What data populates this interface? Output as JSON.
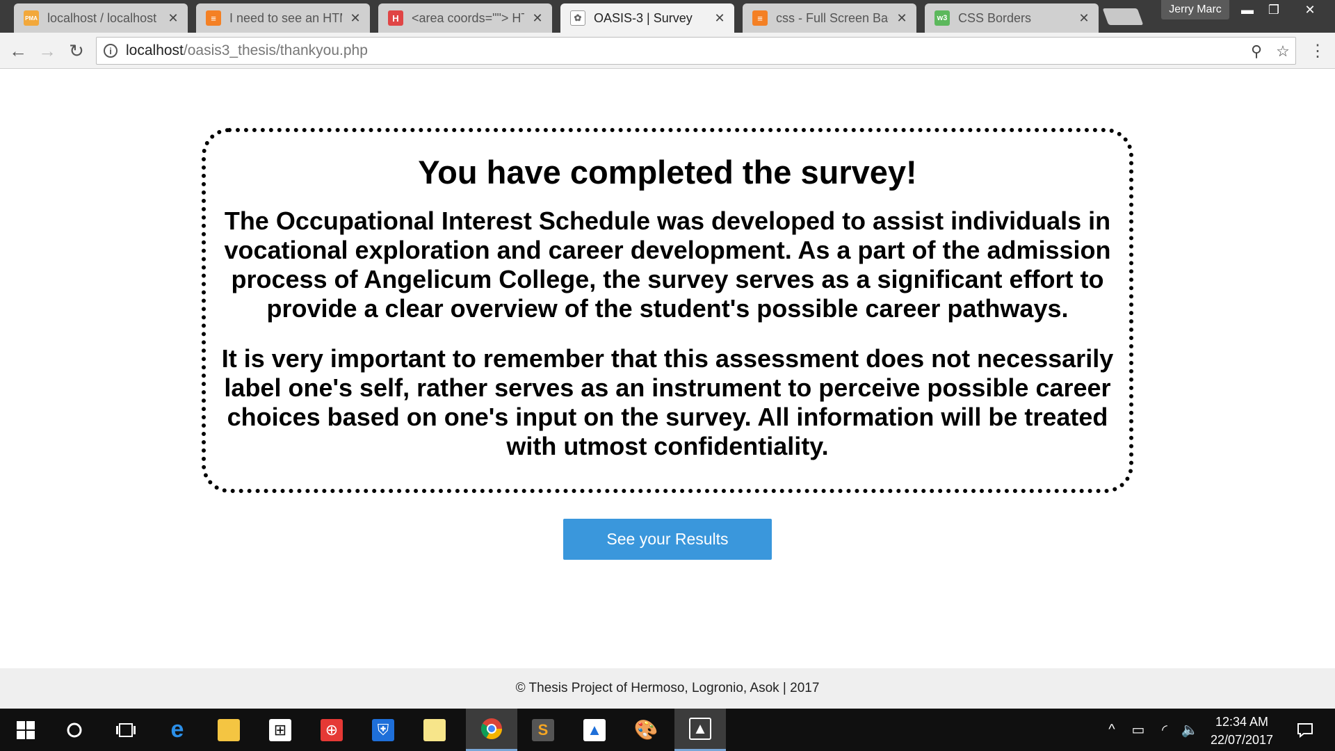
{
  "browser": {
    "tabs": [
      {
        "label": "localhost / localhost /",
        "favicon": "phpmyadmin-icon",
        "color": "#f2a83b",
        "glyph": "PMA"
      },
      {
        "label": "I need to see an HTM",
        "favicon": "stackoverflow-icon",
        "color": "#f48024",
        "glyph": "≡"
      },
      {
        "label": "<area coords=\"\"> HT",
        "favicon": "h-logo-icon",
        "color": "#e04545",
        "glyph": "H"
      },
      {
        "label": "OASIS-3 | Survey",
        "favicon": "oasis-seal-icon",
        "color": "#8a8a5a",
        "glyph": "✿"
      },
      {
        "label": "css - Full Screen Back",
        "favicon": "stackoverflow-icon",
        "color": "#f48024",
        "glyph": "≡"
      },
      {
        "label": "CSS Borders",
        "favicon": "w3schools-icon",
        "color": "#5cb85c",
        "glyph": "w3"
      }
    ],
    "active_tab_index": 3,
    "profile_name": "Jerry Marc",
    "url": {
      "host": "localhost",
      "path": "/oasis3_thesis/thankyou.php"
    }
  },
  "page": {
    "heading": "You have completed the survey!",
    "paragraph1": "The Occupational Interest Schedule was developed to assist individuals in vocational exploration and career development. As a part of the admission process of Angelicum College, the survey serves as a significant effort to provide a clear overview of the student's possible career pathways.",
    "paragraph2": "It is very important to remember that this assessment does not necessarily label one's self, rather serves as an instrument to perceive possible career choices based on one's input on the survey. All information will be treated with utmost confidentiality.",
    "button_label": "See your Results",
    "button_color": "#3a97dc",
    "footer": "© Thesis Project of Hermoso, Logronio, Asok | 2017"
  },
  "taskbar": {
    "time": "12:34 AM",
    "date": "22/07/2017"
  }
}
